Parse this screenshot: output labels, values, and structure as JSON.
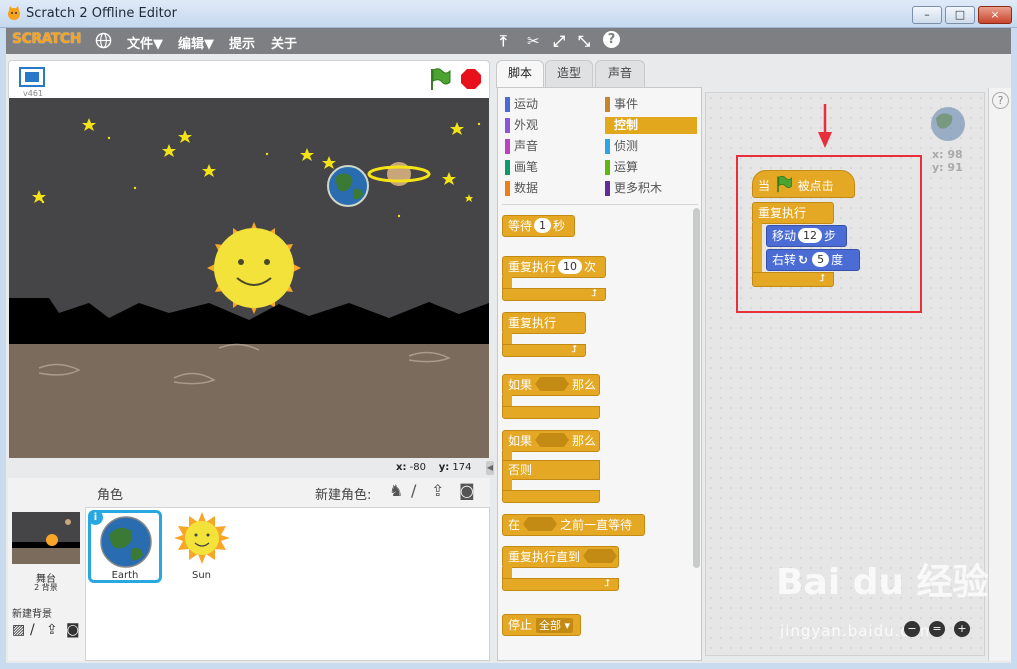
{
  "window": {
    "title": "Scratch 2 Offline Editor",
    "minimize": "–",
    "restore": "□",
    "close": "×"
  },
  "menu": {
    "logo": "SCRATCH",
    "items": [
      {
        "label": "文件▼"
      },
      {
        "label": "编辑▼"
      },
      {
        "label": "提示"
      },
      {
        "label": "关于"
      }
    ]
  },
  "toolbar": {
    "duplicate": "⤒",
    "delete": "✂",
    "grow": "⤢",
    "shrink": "⤡",
    "help": "?"
  },
  "stage": {
    "version": "v461",
    "mouse_x_label": "x:",
    "mouse_x": "-80",
    "mouse_y_label": "y:",
    "mouse_y": "174"
  },
  "sprites_panel": {
    "title": "角色",
    "new_sprite_label": "新建角色:",
    "stage_label": "舞台",
    "backdrops_count": "2 背景",
    "new_backdrop_label": "新建背景",
    "sprites": [
      {
        "name": "Earth",
        "selected": true
      },
      {
        "name": "Sun",
        "selected": false
      }
    ]
  },
  "tabs": [
    {
      "label": "脚本",
      "active": true
    },
    {
      "label": "造型",
      "active": false
    },
    {
      "label": "声音",
      "active": false
    }
  ],
  "categories": [
    {
      "label": "运动",
      "color": "#4a6cd4"
    },
    {
      "label": "事件",
      "color": "#c88330"
    },
    {
      "label": "外观",
      "color": "#8a55d7"
    },
    {
      "label": "控制",
      "color": "#e1a91a",
      "selected": true
    },
    {
      "label": "声音",
      "color": "#bb42c3"
    },
    {
      "label": "侦测",
      "color": "#2ca5e2"
    },
    {
      "label": "画笔",
      "color": "#0e9a6c"
    },
    {
      "label": "运算",
      "color": "#5cb712"
    },
    {
      "label": "数据",
      "color": "#ee7d16"
    },
    {
      "label": "更多积木",
      "color": "#632d99"
    }
  ],
  "palette_blocks": {
    "wait": {
      "label": "等待",
      "value": "1",
      "unit": "秒"
    },
    "repeat": {
      "label": "重复执行",
      "value": "10",
      "unit": "次"
    },
    "forever": {
      "label": "重复执行"
    },
    "if": {
      "label": "如果",
      "then": "那么"
    },
    "if_else": {
      "label": "如果",
      "then": "那么",
      "else": "否则"
    },
    "wait_until": {
      "label": "在",
      "suffix": "之前一直等待"
    },
    "repeat_until": {
      "label": "重复执行直到"
    },
    "stop": {
      "label": "停止",
      "option": "全部 ▾"
    }
  },
  "script": {
    "hat": {
      "pre": "当",
      "post": "被点击"
    },
    "forever": "重复执行",
    "move": {
      "label": "移动",
      "value": "12",
      "unit": "步"
    },
    "turn": {
      "label": "右转",
      "symbol": "↻",
      "value": "5",
      "unit": "度"
    }
  },
  "sprite_info": {
    "x_label": "x:",
    "x": "98",
    "y_label": "y:",
    "y": "91"
  },
  "watermark": {
    "text": "Bai du 经验",
    "url": "jingyan.baidu.com"
  },
  "zoom": {
    "out": "−",
    "reset": "=",
    "in": "+"
  }
}
